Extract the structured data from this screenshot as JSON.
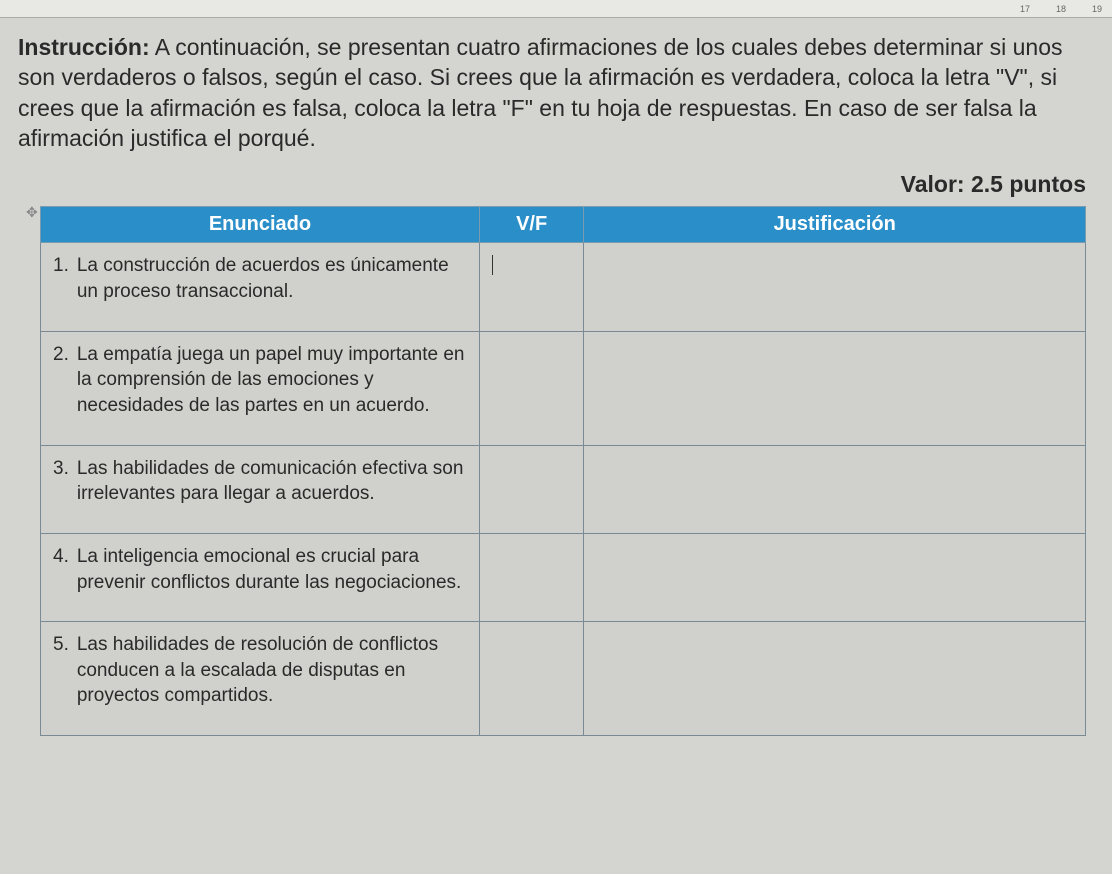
{
  "ruler": {
    "ticks": [
      "17",
      "18",
      "19"
    ]
  },
  "instruction": {
    "label": "Instrucción:",
    "text": "A continuación, se presentan cuatro afirmaciones de los cuales debes determinar si unos son verdaderos o falsos, según el caso. Si crees que la afirmación es verdadera, coloca la letra \"V\", si crees que la afirmación es falsa, coloca la letra \"F\" en tu hoja de respuestas. En caso de ser falsa la afirmación justifica el porqué."
  },
  "valor": "Valor: 2.5 puntos",
  "table": {
    "headers": {
      "enunciado": "Enunciado",
      "vf": "V/F",
      "justificacion": "Justificación"
    },
    "rows": [
      {
        "num": "1.",
        "text": "La construcción de acuerdos es únicamente un proceso transaccional.",
        "vf": "",
        "just": ""
      },
      {
        "num": "2.",
        "text": "La empatía juega un papel muy importante en la comprensión de las emociones y necesidades de las partes en un acuerdo.",
        "vf": "",
        "just": ""
      },
      {
        "num": "3.",
        "text": "Las habilidades de comunicación efectiva son irrelevantes para llegar a acuerdos.",
        "vf": "",
        "just": ""
      },
      {
        "num": "4.",
        "text": "La inteligencia emocional es crucial para prevenir conflictos durante las negociaciones.",
        "vf": "",
        "just": ""
      },
      {
        "num": "5.",
        "text": "Las habilidades de resolución de conflictos conducen a la escalada de disputas en proyectos compartidos.",
        "vf": "",
        "just": ""
      }
    ]
  }
}
